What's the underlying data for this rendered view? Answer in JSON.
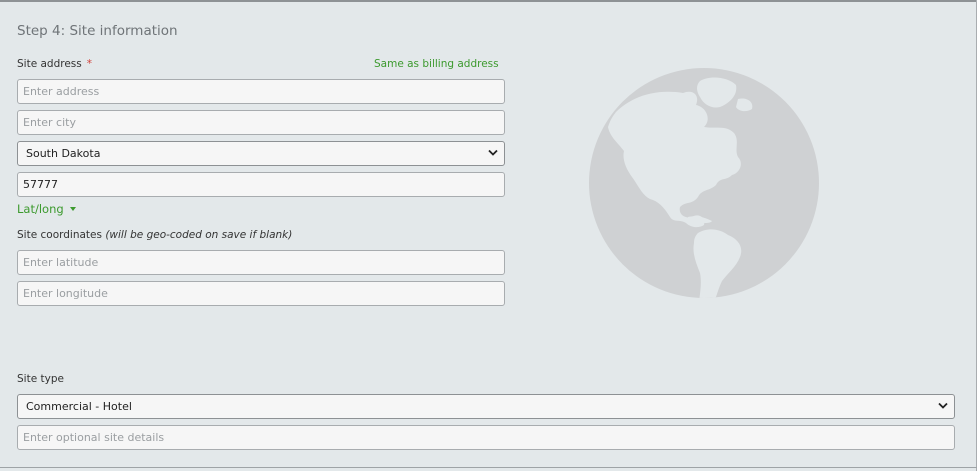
{
  "step_title": "Step 4: Site information",
  "site_address": {
    "label": "Site address",
    "required_mark": "*",
    "same_as_billing": "Same as billing address",
    "address_placeholder": "Enter address",
    "city_placeholder": "Enter city",
    "state_value": "South Dakota",
    "zip_value": "57777"
  },
  "latlong": {
    "toggle_label": "Lat/long",
    "coords_label": "Site coordinates",
    "coords_note": "(will be geo-coded on save if blank)",
    "latitude_placeholder": "Enter latitude",
    "longitude_placeholder": "Enter longitude"
  },
  "site_type": {
    "label": "Site type",
    "selected": "Commercial - Hotel",
    "details_placeholder": "Enter optional site details"
  },
  "colors": {
    "background": "#e3e8ea",
    "link_green": "#3c9a2e",
    "required_red": "#d0423a",
    "globe": "#cfd1d3"
  },
  "icons": {
    "globe": "globe-icon",
    "chevron": "chevron-down-icon"
  }
}
